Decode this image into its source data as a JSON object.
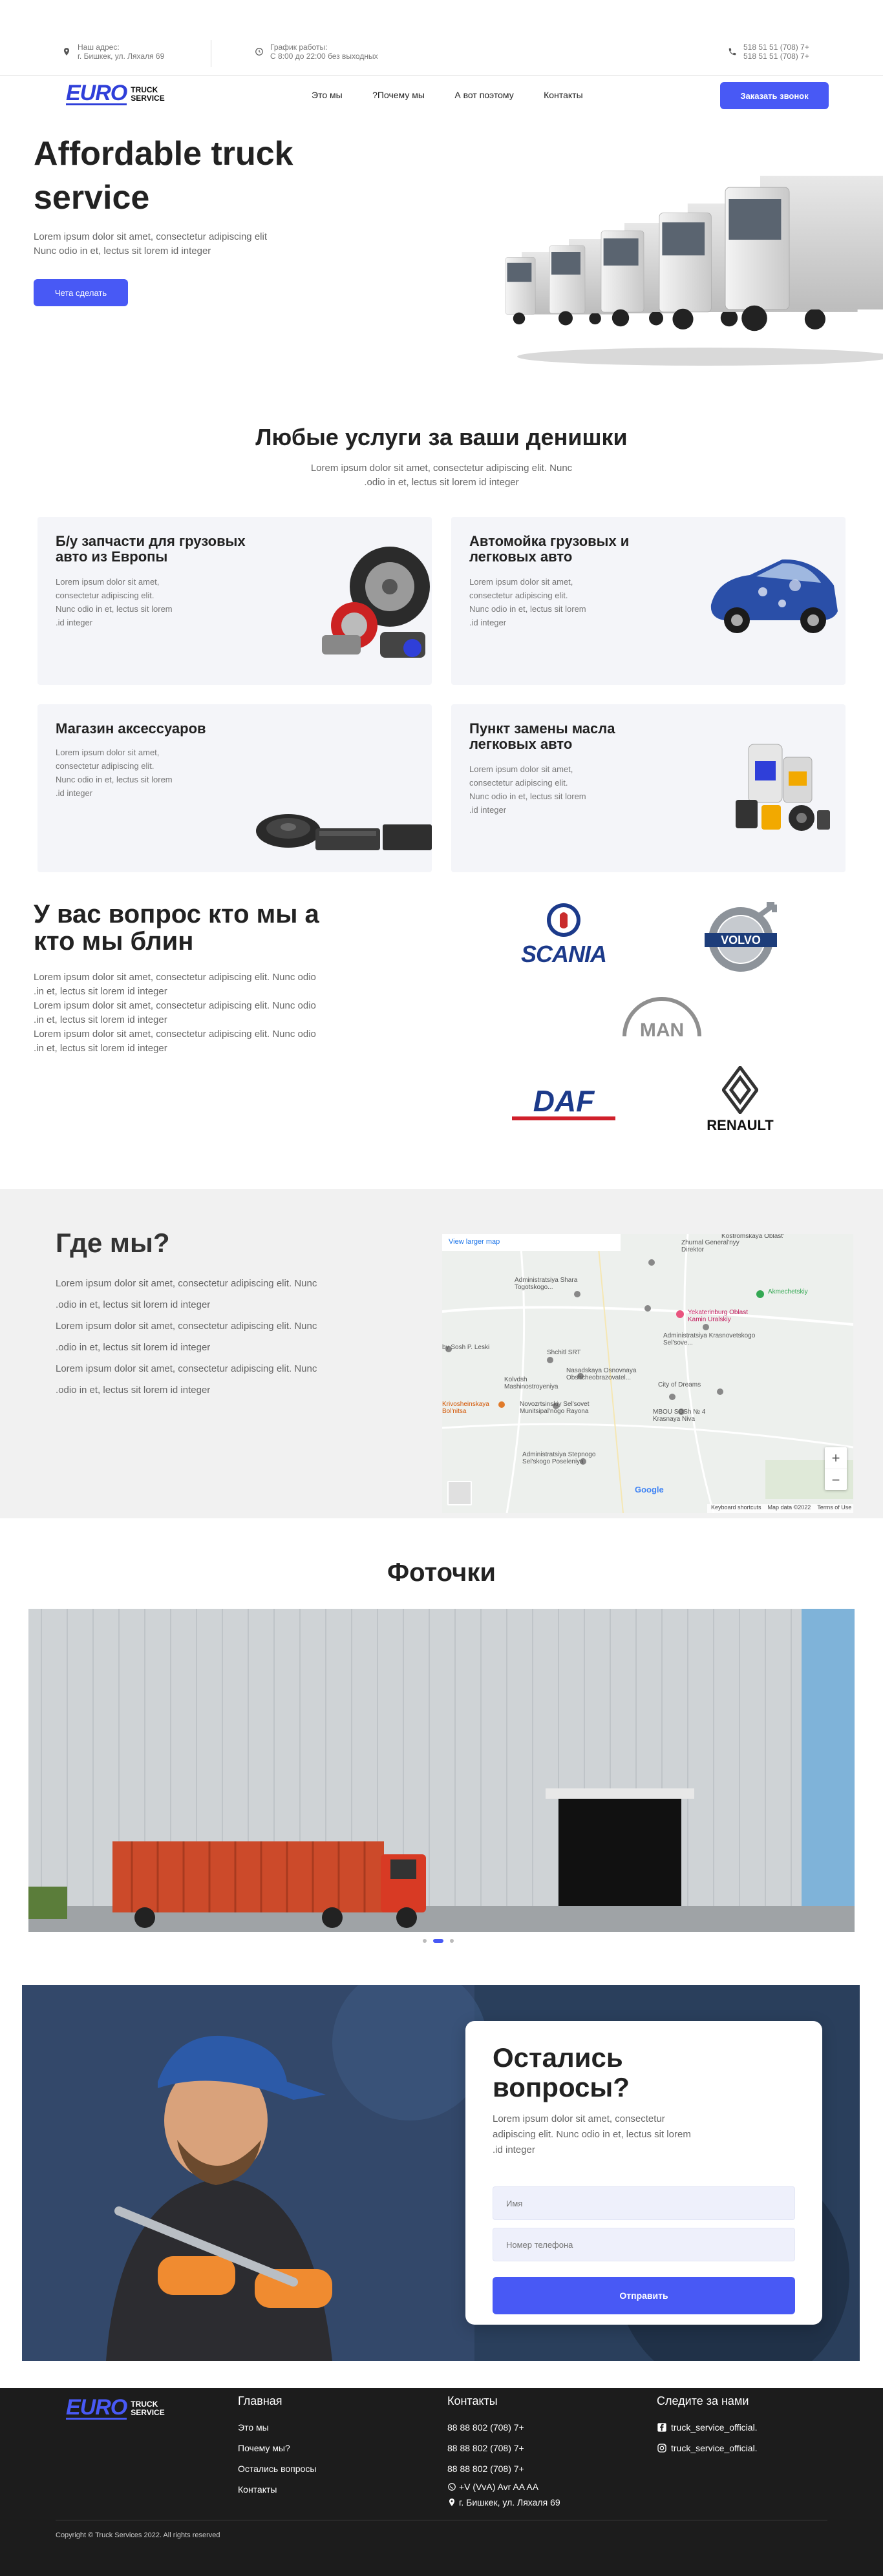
{
  "topbar": {
    "address_label": "Наш адрес:",
    "address_value": "г. Бишкек, ул. Ляхаля 69",
    "hours_label": "График работы:",
    "hours_value": "С 8:00 до 22:00 без выходных",
    "phone1": "518 51 51 (708) 7+",
    "phone2": "518 51 51 (708) 7+"
  },
  "logo": {
    "big": "EURO",
    "line1": "TRUCK",
    "line2": "SERVICE"
  },
  "nav": {
    "items": [
      "Это мы",
      "?Почему мы",
      "А вот поэтому",
      "Контакты"
    ],
    "cta": "Заказать звонок"
  },
  "hero": {
    "title_line1": "Affordable truck",
    "title_line2": "service",
    "text_line1": "Lorem ipsum dolor sit amet, consectetur adipiscing elit",
    "text_line2": "Nunc odio in et, lectus sit lorem id integer",
    "button": "Чета сделать"
  },
  "services": {
    "title": "Любые услуги за ваши денишки",
    "subtitle_line1": "Lorem ipsum dolor sit amet, consectetur adipiscing elit. Nunc",
    "subtitle_line2": ".odio in et, lectus sit lorem id integer",
    "cards": [
      {
        "title1": "Б/у запчасти для грузовых",
        "title2": "авто из Европы",
        "t1": "Lorem ipsum dolor sit amet,",
        "t2": "consectetur adipiscing elit.",
        "t3": "Nunc odio in et, lectus sit lorem",
        "t4": ".id integer"
      },
      {
        "title1": "Автомойка грузовых и",
        "title2": "легковых авто",
        "t1": "Lorem ipsum dolor sit amet,",
        "t2": "consectetur adipiscing elit.",
        "t3": "Nunc odio in et, lectus sit lorem",
        "t4": ".id integer"
      },
      {
        "title1": "Магазин аксессуаров",
        "title2": "",
        "t1": "Lorem ipsum dolor sit amet,",
        "t2": "consectetur adipiscing elit.",
        "t3": "Nunc odio in et, lectus sit lorem",
        "t4": ".id integer"
      },
      {
        "title1": "Пункт замены масла",
        "title2": "легковых авто",
        "t1": "Lorem ipsum dolor sit amet,",
        "t2": "consectetur adipiscing elit.",
        "t3": "Nunc odio in et, lectus sit lorem",
        "t4": ".id integer"
      }
    ]
  },
  "about": {
    "title_line1": "У вас вопрос кто мы а",
    "title_line2": "кто мы блин",
    "lines": [
      "Lorem ipsum dolor sit amet, consectetur adipiscing elit. Nunc odio",
      ".in et, lectus sit lorem id integer",
      "Lorem ipsum dolor sit amet, consectetur adipiscing elit. Nunc odio",
      ".in et, lectus sit lorem id integer",
      "Lorem ipsum dolor sit amet, consectetur adipiscing elit. Nunc odio",
      ".in et, lectus sit lorem id integer"
    ],
    "brands": [
      "SCANIA",
      "VOLVO",
      "MAN",
      "DAF",
      "RENAULT"
    ]
  },
  "location": {
    "title": "Где мы?",
    "lines": [
      "Lorem ipsum dolor sit amet, consectetur adipiscing elit. Nunc",
      ".odio in et, lectus sit lorem id integer",
      "Lorem ipsum dolor sit amet, consectetur adipiscing elit. Nunc",
      ".odio in et, lectus sit lorem id integer",
      "Lorem ipsum dolor sit amet, consectetur adipiscing elit. Nunc",
      ".odio in et, lectus sit lorem id integer"
    ],
    "map": {
      "view_larger": "View larger map",
      "zoom_in": "+",
      "zoom_out": "−",
      "footer_shortcuts": "Keyboard shortcuts",
      "footer_data": "Map data ©2022",
      "footer_terms": "Terms of Use",
      "google": "Google",
      "labels": [
        "Zhurnal General'nyy Direktor",
        "Kostromskaya Oblast'",
        "Administratsiya Shara Togotskogo...",
        "Akmechetskiy",
        "Yekaterinburg Oblast Kamin Uralskiy",
        "Administratsiya Krasnovetskogo Sel'sove...",
        "Shchitl SRT",
        "Nasadskaya Osnovnaya Obshcheobrazovatel...",
        "Kolvdsh Mashinostroyeniya",
        "City of Dreams",
        "Krivosheinskaya Bol'nitsa",
        "Novozrtsinskiy Sel'sovet Munitsipal'nogo Rayona",
        "MBOU SOSh № 4 Krasnaya Niva",
        "Administratsiya Stepnogo Sel'skogo Poseleniya",
        "by Sosh P. Leski",
        "Zhurnal Generalnyy Direktor"
      ]
    }
  },
  "photos": {
    "title": "Фоточки",
    "dots": 3,
    "active_dot": 1
  },
  "contact": {
    "title_line1": "Остались",
    "title_line2": "вопросы?",
    "text_line1": "Lorem ipsum dolor sit amet, consectetur",
    "text_line2": "adipiscing elit. Nunc odio in et, lectus sit lorem",
    "text_line3": ".id integer",
    "name_placeholder": "Имя",
    "phone_placeholder": "Номер телефона",
    "submit": "Отправить"
  },
  "footer": {
    "col1_title": "Главная",
    "col1_items": [
      "Это мы",
      "Почему мы?",
      "Остались вопросы",
      "Контакты"
    ],
    "col2_title": "Контакты",
    "col2_items": [
      "88 88 802 (708) 7+",
      "88 88 802 (708) 7+",
      "88 88 802 (708) 7+",
      "+V (VvA) Avr AA AA"
    ],
    "col2_address": "г. Бишкек, ул. Ляхаля 69",
    "col3_title": "Следите за нами",
    "col3_items": [
      "truck_service_official.",
      "truck_service_official."
    ],
    "copyright": "Copyright © Truck Services 2022. All rights reserved"
  },
  "colors": {
    "accent": "#4859f5",
    "logo": "#2f3fd9",
    "footer_bg": "#1c1c1c",
    "card_bg": "#f4f5f9"
  }
}
